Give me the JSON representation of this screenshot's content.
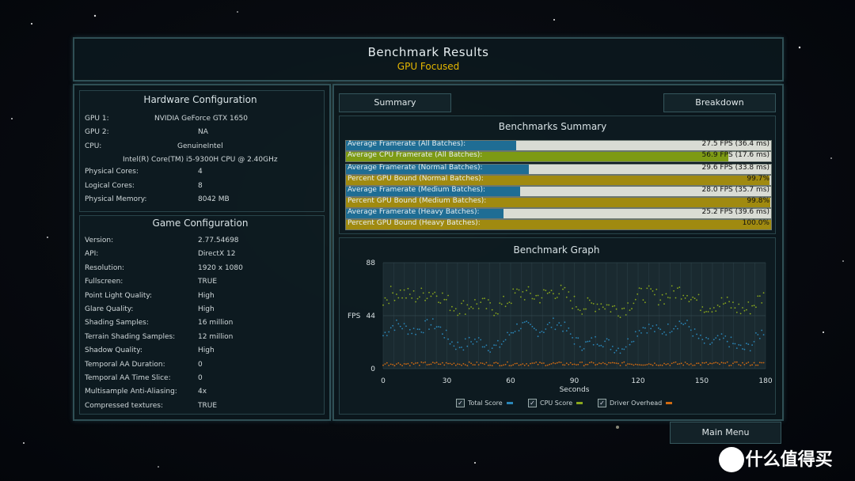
{
  "header": {
    "title": "Benchmark Results",
    "subtitle": "GPU Focused"
  },
  "hardware": {
    "title": "Hardware Configuration",
    "rows": [
      {
        "label": "GPU 1:",
        "value": "NVIDIA GeForce GTX 1650"
      },
      {
        "label": "GPU 2:",
        "value": "NA"
      },
      {
        "label": "CPU:",
        "value": "GenuineIntel"
      },
      {
        "label": "",
        "value": "Intel(R) Core(TM) i5-9300H CPU @ 2.40GHz"
      },
      {
        "label": "Physical Cores:",
        "value": "4"
      },
      {
        "label": "Logical Cores:",
        "value": "8"
      },
      {
        "label": "Physical Memory:",
        "value": "8042  MB"
      }
    ]
  },
  "game": {
    "title": "Game Configuration",
    "rows": [
      {
        "label": "Version:",
        "value": "2.77.54698"
      },
      {
        "label": "API:",
        "value": "DirectX 12"
      },
      {
        "label": "Resolution:",
        "value": "1920 x 1080"
      },
      {
        "label": "Fullscreen:",
        "value": "TRUE"
      },
      {
        "label": "Point Light Quality:",
        "value": "High"
      },
      {
        "label": "Glare Quality:",
        "value": "High"
      },
      {
        "label": "Shading Samples:",
        "value": "16 million"
      },
      {
        "label": "Terrain Shading Samples:",
        "value": "12 million"
      },
      {
        "label": "Shadow Quality:",
        "value": "High"
      },
      {
        "label": "Temporal AA Duration:",
        "value": "0"
      },
      {
        "label": "Temporal AA Time Slice:",
        "value": "0"
      },
      {
        "label": "Multisample Anti-Aliasing:",
        "value": "4x"
      },
      {
        "label": "Compressed textures:",
        "value": "TRUE"
      }
    ]
  },
  "tabs": {
    "summary": "Summary",
    "breakdown": "Breakdown"
  },
  "summary": {
    "title": "Benchmarks Summary",
    "rows": [
      {
        "label": "Average Framerate (All Batches):",
        "value": "27.5 FPS (36.4 ms)",
        "fill": 0.4,
        "color": "#1f6d94"
      },
      {
        "label": "Average CPU Framerate (All Batches):",
        "value": "56.9 FPS (17.6 ms)",
        "fill": 0.9,
        "color": "#7d9a14"
      },
      {
        "label": "Average Framerate (Normal Batches):",
        "value": "29.6 FPS (33.8 ms)",
        "fill": 0.43,
        "color": "#1f6d94"
      },
      {
        "label": "Percent GPU Bound (Normal Batches):",
        "value": "99.7%",
        "fill": 0.997,
        "color": "#a08a10"
      },
      {
        "label": "Average Framerate (Medium Batches):",
        "value": "28.0 FPS (35.7 ms)",
        "fill": 0.41,
        "color": "#1f6d94"
      },
      {
        "label": "Percent GPU Bound (Medium Batches):",
        "value": "99.8%",
        "fill": 0.998,
        "color": "#a08a10"
      },
      {
        "label": "Average Framerate (Heavy Batches):",
        "value": "25.2 FPS (39.6 ms)",
        "fill": 0.37,
        "color": "#1f6d94"
      },
      {
        "label": "Percent GPU Bound (Heavy Batches):",
        "value": "100.0%",
        "fill": 1.0,
        "color": "#a08a10"
      }
    ]
  },
  "graph": {
    "title": "Benchmark Graph"
  },
  "chart_data": {
    "type": "scatter",
    "title": "Benchmark Graph",
    "xlabel": "Seconds",
    "ylabel": "FPS",
    "xlim": [
      0,
      180
    ],
    "ylim": [
      0,
      88
    ],
    "xticks": [
      "0",
      "30",
      "60",
      "90",
      "120",
      "150",
      "180"
    ],
    "yticks": [
      "0",
      "44",
      "88"
    ],
    "grid": true,
    "legend": "bottom",
    "series": [
      {
        "name": "Total Score",
        "color": "#2a86b8",
        "values_approx_mean": 27.5
      },
      {
        "name": "CPU Score",
        "color": "#8aa81c",
        "values_approx_mean": 56.9
      },
      {
        "name": "Driver Overhead",
        "color": "#d06a12",
        "values_approx_mean": 4
      }
    ]
  },
  "legend": {
    "total": "Total Score",
    "cpu": "CPU Score",
    "driver": "Driver Overhead",
    "check": "✓"
  },
  "main_menu": "Main Menu",
  "watermark": "值 什么值得买"
}
